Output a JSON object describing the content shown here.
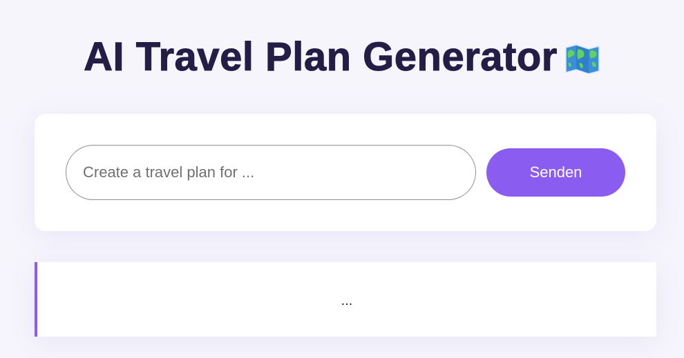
{
  "header": {
    "title": "AI Travel Plan Generator",
    "icon": "world-map-icon"
  },
  "form": {
    "input_value": "",
    "input_placeholder": "Create a travel plan for ...",
    "send_label": "Senden"
  },
  "result": {
    "text": "..."
  },
  "colors": {
    "background": "#f6f5fc",
    "title": "#241e46",
    "accent": "#8b5cf0",
    "card": "#ffffff"
  }
}
